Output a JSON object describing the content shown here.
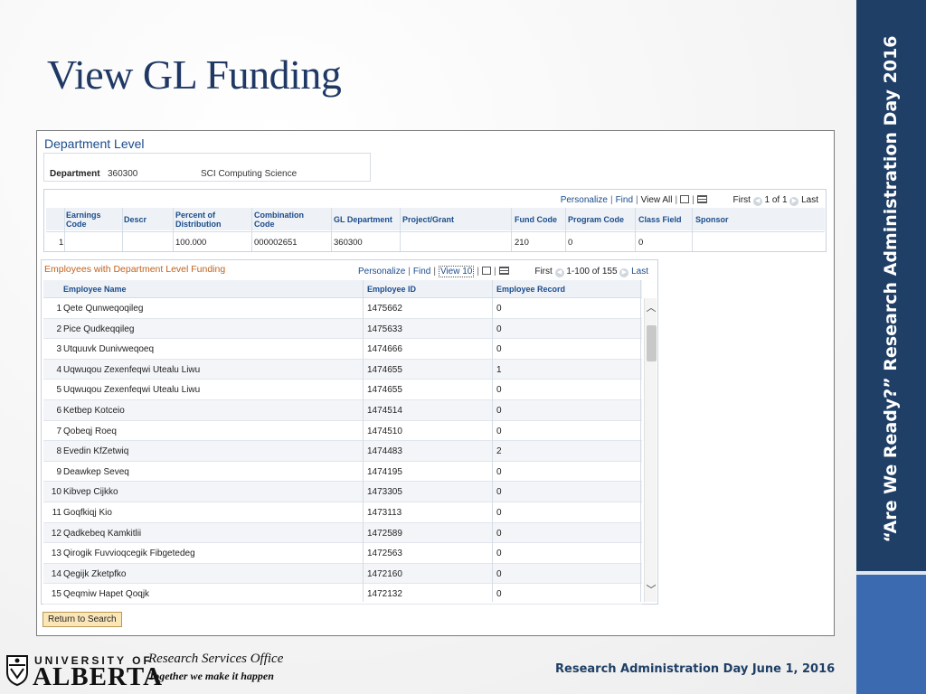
{
  "slide": {
    "title": "View GL Funding",
    "side_text": "“Are We Ready?” Research Administration Day 2016",
    "footer_right": "Research Administration Day June 1, 2016",
    "office_title": "Research Services Office",
    "office_tagline": "Together we make it happen",
    "logo_top": "UNIVERSITY OF",
    "logo_big": "ALBERTA"
  },
  "colors": {
    "title": "#1f3864",
    "side_band": "#1f3f66",
    "link": "#1b4c8c",
    "caption": "#c0621e"
  },
  "panel": {
    "heading": "Department Level",
    "department": {
      "label": "Department",
      "value": "360300",
      "description": "SCI Computing Science"
    },
    "grid1": {
      "nav": {
        "personalize": "Personalize",
        "find": "Find",
        "view_all": "View All",
        "first": "First",
        "range": "1 of 1",
        "last": "Last"
      },
      "headers": {
        "earnings_code": "Earnings Code",
        "descr": "Descr",
        "percent": "Percent of Distribution",
        "combination": "Combination Code",
        "gl_dept": "GL Department",
        "project": "Project/Grant",
        "fund": "Fund Code",
        "program": "Program Code",
        "class": "Class Field",
        "sponsor": "Sponsor"
      },
      "row": {
        "num": "1",
        "earnings_code": "",
        "descr": "",
        "percent": "100.000",
        "combination": "000002651",
        "gl_dept": "360300",
        "project": "",
        "fund": "210",
        "program": "0",
        "class": "0",
        "sponsor": ""
      }
    },
    "grid2": {
      "caption": "Employees with Department Level Funding",
      "nav": {
        "personalize": "Personalize",
        "find": "Find",
        "view": "View 10",
        "first": "First",
        "range": "1-100 of 155",
        "last": "Last"
      },
      "headers": {
        "name": "Employee Name",
        "id": "Employee ID",
        "record": "Employee Record"
      },
      "rows": [
        {
          "num": "1",
          "name": "Qete Qunweqoqileg",
          "id": "1475662",
          "record": "0"
        },
        {
          "num": "2",
          "name": "Pice Qudkeqqileg",
          "id": "1475633",
          "record": "0"
        },
        {
          "num": "3",
          "name": "Utquuvk Dunivweqoeq",
          "id": "1474666",
          "record": "0"
        },
        {
          "num": "4",
          "name": "Uqwuqou Zexenfeqwi Utealu Liwu",
          "id": "1474655",
          "record": "1"
        },
        {
          "num": "5",
          "name": "Uqwuqou Zexenfeqwi Utealu Liwu",
          "id": "1474655",
          "record": "0"
        },
        {
          "num": "6",
          "name": "Ketbep Kotceio",
          "id": "1474514",
          "record": "0"
        },
        {
          "num": "7",
          "name": "Qobeqj Roeq",
          "id": "1474510",
          "record": "0"
        },
        {
          "num": "8",
          "name": "Evedin KfZetwiq",
          "id": "1474483",
          "record": "2"
        },
        {
          "num": "9",
          "name": "Deawkep Seveq",
          "id": "1474195",
          "record": "0"
        },
        {
          "num": "10",
          "name": "Kibvep Cijkko",
          "id": "1473305",
          "record": "0"
        },
        {
          "num": "11",
          "name": "Goqfkiqj Kio",
          "id": "1473113",
          "record": "0"
        },
        {
          "num": "12",
          "name": "Qadkebeq Kamkitlii",
          "id": "1472589",
          "record": "0"
        },
        {
          "num": "13",
          "name": "Qirogik Fuvvioqcegik Fibgetedeg",
          "id": "1472563",
          "record": "0"
        },
        {
          "num": "14",
          "name": "Qegijk Zketpfko",
          "id": "1472160",
          "record": "0"
        },
        {
          "num": "15",
          "name": "Qeqmiw Hapet Qoqjk",
          "id": "1472132",
          "record": "0"
        }
      ]
    },
    "return_button": "Return to Search"
  }
}
